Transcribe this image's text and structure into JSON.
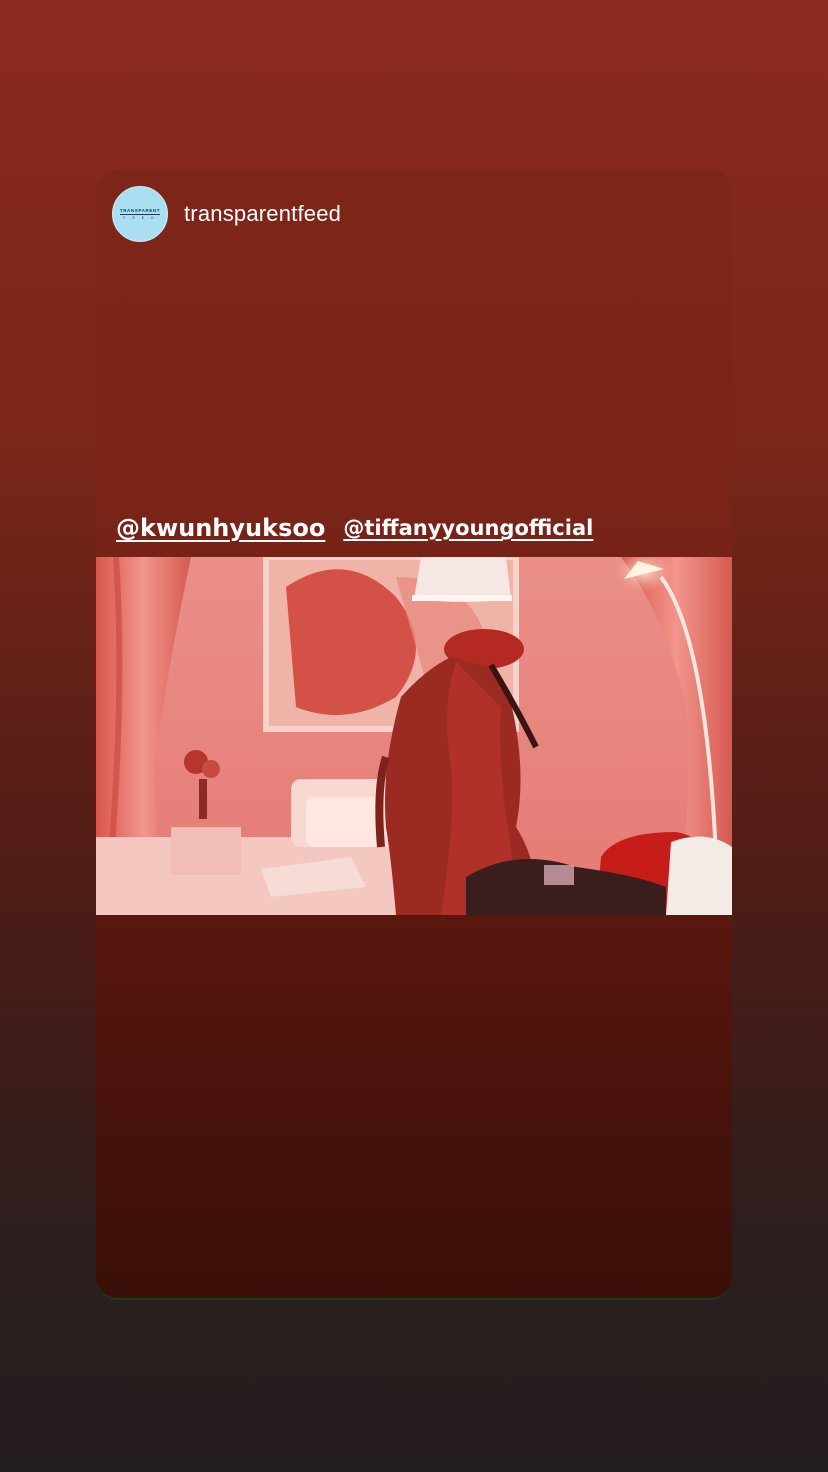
{
  "story": {
    "username": "transparentfeed",
    "avatar": {
      "brand_text": "TRANSPARENT",
      "sub_text": "F E E D",
      "color": "#a9dff0"
    },
    "mentions": [
      {
        "label": "@kwunhyuksoo"
      },
      {
        "label": "@tiffanyyoungofficial"
      }
    ]
  },
  "colors": {
    "background_top": "#8c2a1f",
    "background_bottom": "#241d1e",
    "card_top": "#7e2519",
    "video_tint": "#e7807c"
  }
}
